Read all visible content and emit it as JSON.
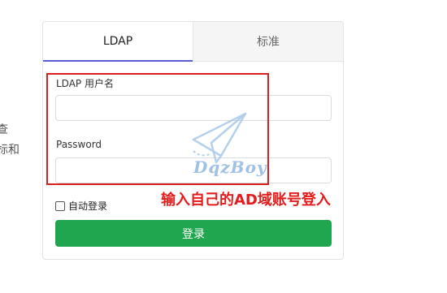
{
  "background_text": {
    "line1": "查",
    "line2": "标和"
  },
  "tabs": [
    {
      "label": "LDAP",
      "active": true
    },
    {
      "label": "标准",
      "active": false
    }
  ],
  "form": {
    "username_label": "LDAP 用户名",
    "username_value": "",
    "password_label": "Password",
    "password_value": "",
    "remember_label": "自动登录",
    "remember_checked": false,
    "submit_label": "登录"
  },
  "annotation": {
    "text": "输入自己的AD域账号登入",
    "color": "#e51c1c"
  },
  "watermark": {
    "text": "DqzBoy"
  },
  "colors": {
    "accent": "#5b5bd6",
    "button": "#21a650",
    "highlight_box": "#d81e1e"
  }
}
